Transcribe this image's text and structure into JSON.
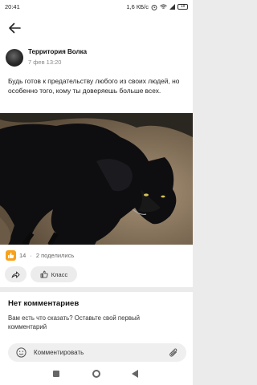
{
  "status": {
    "time": "20:41",
    "net_speed": "1,6 КБ/с",
    "battery": "18"
  },
  "post": {
    "author": "Территория Волка",
    "date": "7 фев 13:20",
    "text": "Будь готов к предательству любого из своих людей, но особенно того, кому ты доверяешь больше всех.",
    "likes": "14",
    "shares": "2 поделились",
    "class_label": "Класс"
  },
  "comments": {
    "title": "Нет комментариев",
    "subtitle": "Вам есть что сказать? Оставьте свой первый комментарий",
    "input_placeholder": "Комментировать"
  },
  "colors": {
    "like_badge": "#f7a21b",
    "background": "#ebebeb"
  },
  "icons": [
    "back-arrow-icon",
    "like-icon",
    "share-icon",
    "class-thumb-icon",
    "smile-icon",
    "attach-clip-icon",
    "wifi-icon",
    "signal-icon",
    "alarm-icon",
    "battery-icon"
  ]
}
